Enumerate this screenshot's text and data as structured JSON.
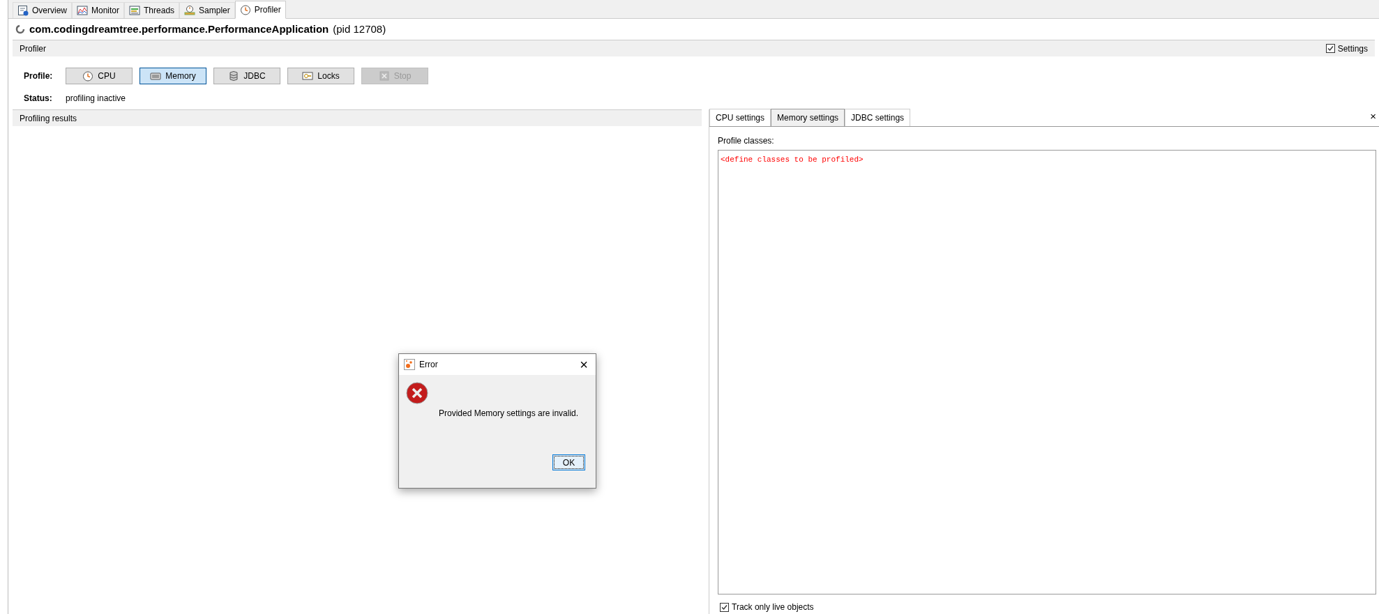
{
  "tabs": [
    {
      "label": "Overview",
      "kind": "overview",
      "selected": false
    },
    {
      "label": "Monitor",
      "kind": "monitor",
      "selected": false
    },
    {
      "label": "Threads",
      "kind": "threads",
      "selected": false
    },
    {
      "label": "Sampler",
      "kind": "sampler",
      "selected": false
    },
    {
      "label": "Profiler",
      "kind": "clock",
      "selected": true
    }
  ],
  "header": {
    "app": "com.codingdreamtree.performance.PerformanceApplication",
    "pid": "(pid 12708)"
  },
  "section": {
    "title": "Profiler",
    "settings": {
      "label": "Settings",
      "checked": true
    }
  },
  "profile": {
    "label": "Profile:",
    "buttons": [
      {
        "label": "CPU",
        "kind": "clock",
        "selected": false,
        "disabled": false
      },
      {
        "label": "Memory",
        "kind": "memory",
        "selected": true,
        "disabled": false
      },
      {
        "label": "JDBC",
        "kind": "database",
        "selected": false,
        "disabled": false
      },
      {
        "label": "Locks",
        "kind": "lock",
        "selected": false,
        "disabled": false
      },
      {
        "label": "Stop",
        "kind": "stop",
        "selected": false,
        "disabled": true
      }
    ]
  },
  "status": {
    "label": "Status:",
    "value": "profiling inactive"
  },
  "results": {
    "title": "Profiling results"
  },
  "settings_tabs": [
    {
      "label": "CPU settings",
      "selected": false
    },
    {
      "label": "Memory settings",
      "selected": true
    },
    {
      "label": "JDBC settings",
      "selected": false
    }
  ],
  "settings_close": "×",
  "profile_classes": {
    "label": "Profile classes:",
    "value": "<define classes to be profiled>"
  },
  "track_live": {
    "label": "Track only live objects",
    "checked": true
  },
  "dialog": {
    "title": "Error",
    "close": "×",
    "message": "Provided Memory settings are invalid.",
    "ok": "OK"
  }
}
